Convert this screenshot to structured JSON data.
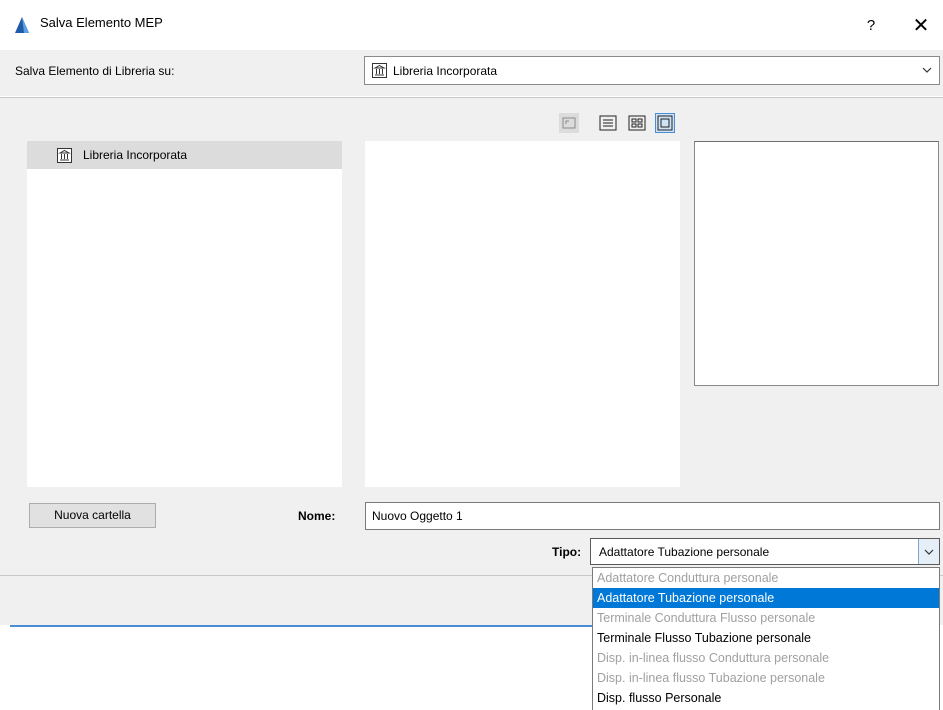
{
  "window": {
    "title": "Salva Elemento MEP",
    "help_label": "?",
    "close_label": "✕"
  },
  "save_to": {
    "label": "Salva Elemento di Libreria su:",
    "selected": "Libreria Incorporata"
  },
  "toolbar": {
    "icons": [
      "folder-up-icon",
      "list-view-icon",
      "grid-view-icon",
      "preview-view-icon"
    ]
  },
  "tree": {
    "items": [
      {
        "label": "Libreria Incorporata",
        "icon": "library-icon"
      }
    ]
  },
  "new_folder_label": "Nuova cartella",
  "name_field": {
    "label": "Nome:",
    "value": "Nuovo Oggetto 1"
  },
  "type_field": {
    "label": "Tipo:",
    "selected": "Adattatore Tubazione personale",
    "options": [
      {
        "label": "Adattatore Conduttura personale",
        "state": "disabled"
      },
      {
        "label": "Adattatore Tubazione personale",
        "state": "selected"
      },
      {
        "label": "Terminale Conduttura Flusso personale",
        "state": "disabled"
      },
      {
        "label": "Terminale Flusso Tubazione personale",
        "state": "enabled"
      },
      {
        "label": "Disp. in-linea flusso Conduttura personale",
        "state": "disabled"
      },
      {
        "label": "Disp. in-linea flusso Tubazione personale",
        "state": "disabled"
      },
      {
        "label": "Disp. flusso Personale",
        "state": "enabled"
      }
    ]
  },
  "colors": {
    "selection": "#0078d7",
    "accent": "#4a8cd6",
    "disabled_text": "#a0a0a0"
  }
}
